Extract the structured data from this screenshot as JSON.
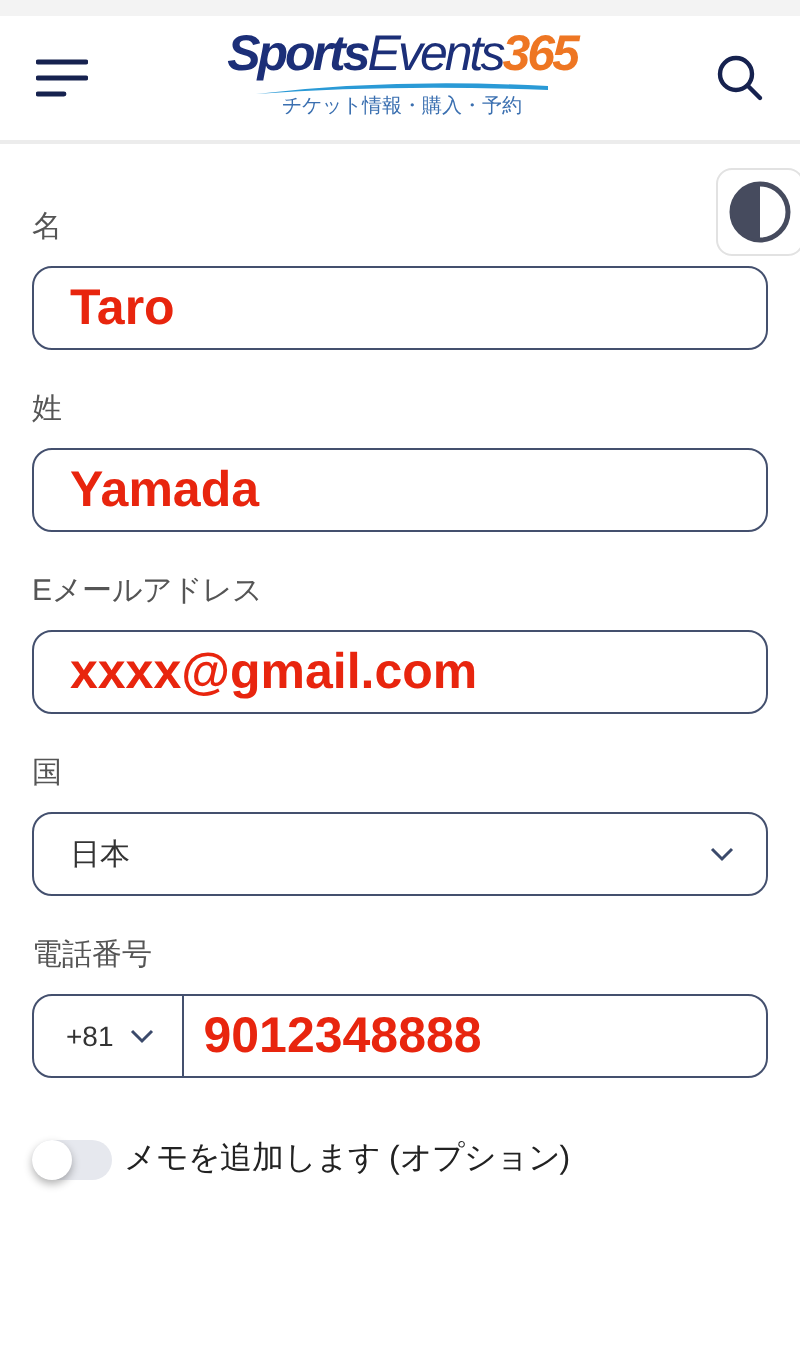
{
  "header": {
    "logo": {
      "text": "**Sports**Events",
      "number": "365",
      "tagline": "チケット情報・購入・予約"
    }
  },
  "fields": [
    {
      "kind": "text",
      "label": "名",
      "value": "Taro"
    },
    {
      "kind": "text",
      "label": "姓",
      "value": "Yamada"
    },
    {
      "kind": "text",
      "label": "Eメールアドレス",
      "value": "xxxx@gmail.com"
    },
    {
      "kind": "select",
      "label": "国",
      "value": "日本"
    },
    {
      "kind": "phone",
      "label": "電話番号",
      "code": "+81",
      "value": "9012348888"
    }
  ],
  "note_toggle": {
    "label": "メモを追加します (オプション)",
    "on": false
  }
}
